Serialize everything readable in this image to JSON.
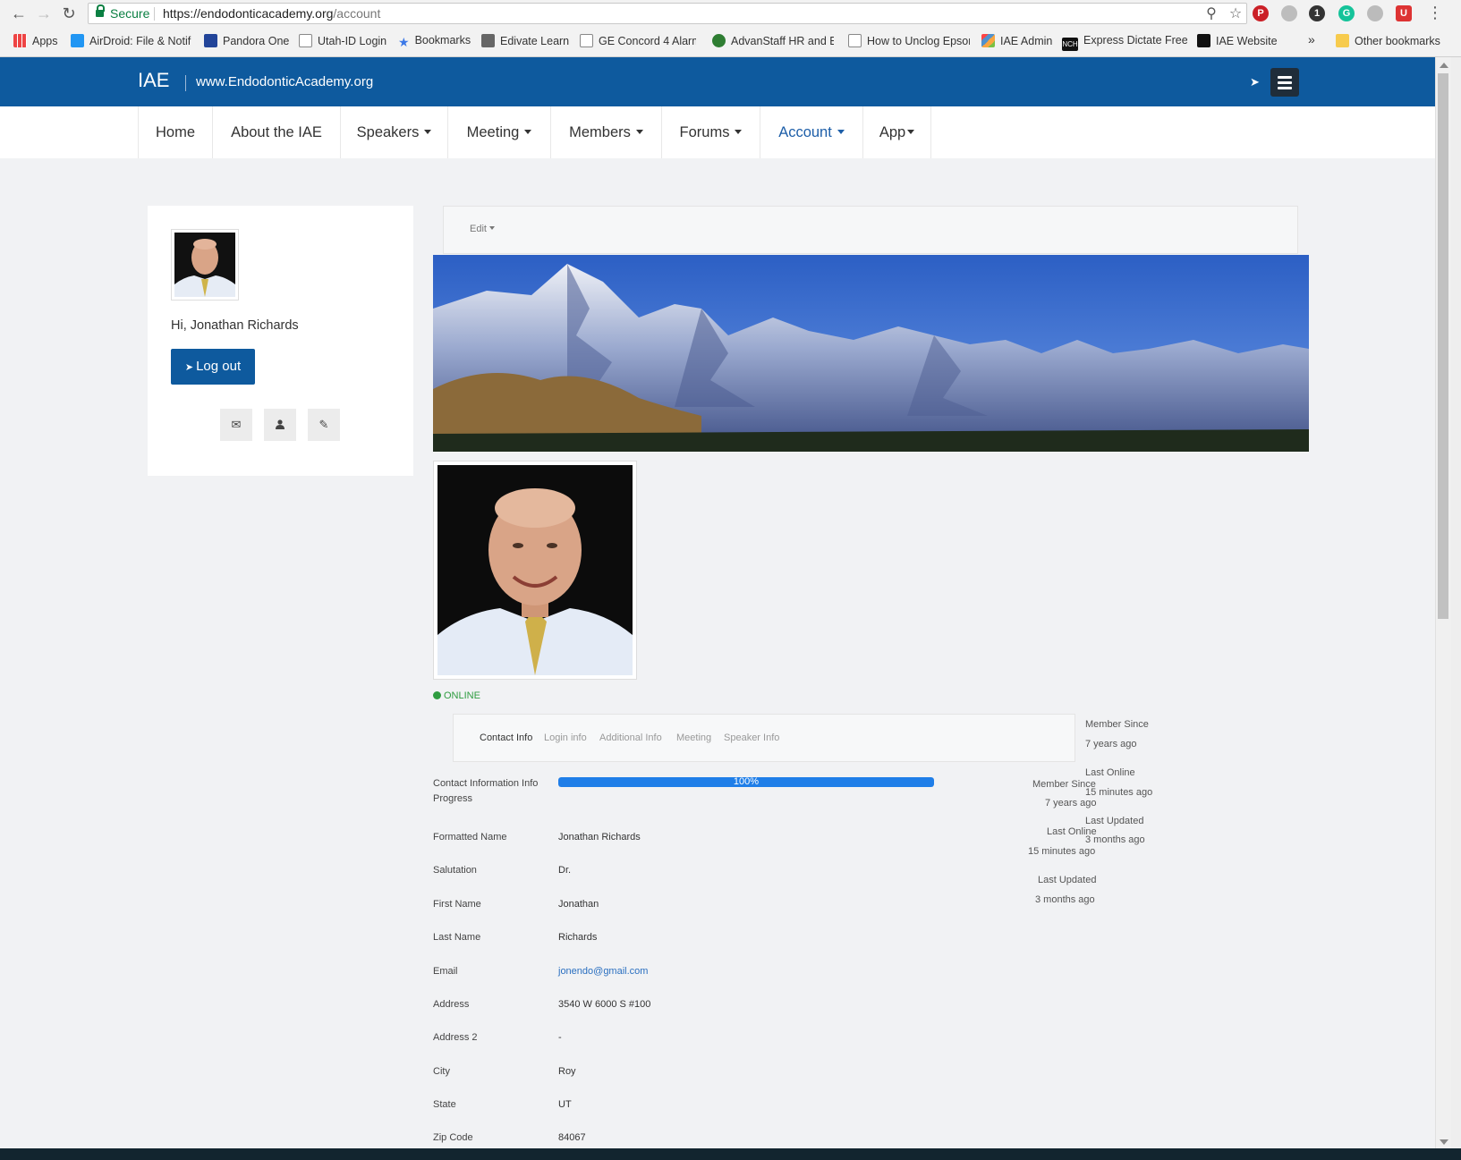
{
  "browser": {
    "secure_label": "Secure",
    "url_host": "https://endodonticacademy.org",
    "url_path": "/account",
    "bookmarks": [
      {
        "label": "Apps",
        "icon": "apps-grid-icon"
      },
      {
        "label": "AirDroid: File & Notif",
        "icon": "airdroid-icon"
      },
      {
        "label": "Pandora One",
        "icon": "pandora-icon"
      },
      {
        "label": "Utah-ID Login",
        "icon": "page-icon"
      },
      {
        "label": "Bookmarks",
        "icon": "star-icon"
      },
      {
        "label": "Edivate Learn",
        "icon": "edivate-icon"
      },
      {
        "label": "GE Concord 4 Alarm",
        "icon": "page-icon"
      },
      {
        "label": "AdvanStaff HR and E",
        "icon": "advanstaff-icon"
      },
      {
        "label": "How to Unclog Epsor",
        "icon": "page-icon"
      },
      {
        "label": "IAE Admin",
        "icon": "joomla-icon"
      },
      {
        "label": "Express Dictate Free",
        "icon": "nch-icon"
      },
      {
        "label": "IAE Website",
        "icon": "joomla-icon"
      }
    ],
    "overflow_label": "»",
    "other_bookmarks": "Other bookmarks"
  },
  "site": {
    "brand": "IAE",
    "brand_url": "www.EndodonticAcademy.org",
    "header_bg": "#0e5a9e"
  },
  "nav": [
    {
      "label": "Home",
      "caret": false
    },
    {
      "label": "About the IAE",
      "caret": false
    },
    {
      "label": "Speakers",
      "caret": true
    },
    {
      "label": "Meeting",
      "caret": true
    },
    {
      "label": "Members",
      "caret": true
    },
    {
      "label": "Forums",
      "caret": true
    },
    {
      "label": "Account",
      "caret": true,
      "active": true
    },
    {
      "label": "App",
      "caret": true
    }
  ],
  "sidebar": {
    "greeting": "Hi, Jonathan Richards",
    "logout_label": "Log out",
    "actions": [
      "envelope-icon",
      "user-icon",
      "pencil-icon"
    ]
  },
  "profile": {
    "edit_label": "Edit",
    "status": "ONLINE",
    "tabs": [
      "Contact Info",
      "Login info",
      "Additional Info",
      "Meeting",
      "Speaker Info"
    ],
    "stats": {
      "member_since_label": "Member Since",
      "member_since": "7 years ago",
      "last_online_label": "Last Online",
      "last_online": "15 minutes ago",
      "last_updated_label": "Last Updated",
      "last_updated": "3 months ago"
    },
    "progress": {
      "label": "Contact Information Info Progress",
      "value_text": "100%",
      "value": 100
    },
    "fields": [
      {
        "label": "Formatted Name",
        "value": "Jonathan Richards"
      },
      {
        "label": "Salutation",
        "value": "Dr."
      },
      {
        "label": "First Name",
        "value": "Jonathan"
      },
      {
        "label": "Last Name",
        "value": "Richards"
      },
      {
        "label": "Email",
        "value": "jonendo@gmail.com",
        "link": true
      },
      {
        "label": "Address",
        "value": "3540 W 6000 S #100"
      },
      {
        "label": "Address 2",
        "value": "-"
      },
      {
        "label": "City",
        "value": "Roy"
      },
      {
        "label": "State",
        "value": "UT"
      },
      {
        "label": "Zip Code",
        "value": "84067"
      }
    ]
  }
}
